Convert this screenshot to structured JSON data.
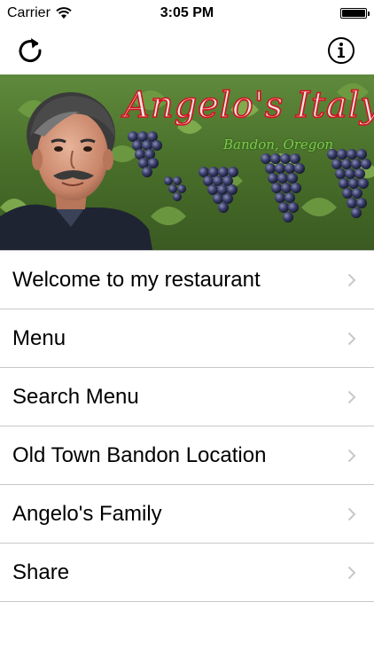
{
  "status_bar": {
    "carrier": "Carrier",
    "time": "3:05 PM",
    "battery_level": 1.0,
    "icons": [
      "wifi-icon",
      "battery-icon"
    ]
  },
  "nav": {
    "left_icon": "refresh-icon",
    "right_icon": "info-icon"
  },
  "banner": {
    "title": "Angelo's Italy",
    "subtitle": "Bandon, Oregon"
  },
  "menu": {
    "items": [
      {
        "label": "Welcome to my restaurant",
        "icon": "chevron-right-icon"
      },
      {
        "label": "Menu",
        "icon": "chevron-right-icon"
      },
      {
        "label": "Search Menu",
        "icon": "chevron-right-icon"
      },
      {
        "label": "Old Town Bandon Location",
        "icon": "chevron-right-icon"
      },
      {
        "label": "Angelo's Family",
        "icon": "chevron-right-icon"
      },
      {
        "label": "Share",
        "icon": "chevron-right-icon"
      }
    ]
  },
  "colors": {
    "title_red": "#d2141e",
    "subtitle_green": "#7ec84a",
    "separator": "#c8c7cc",
    "chevron": "#c7c7cc"
  }
}
